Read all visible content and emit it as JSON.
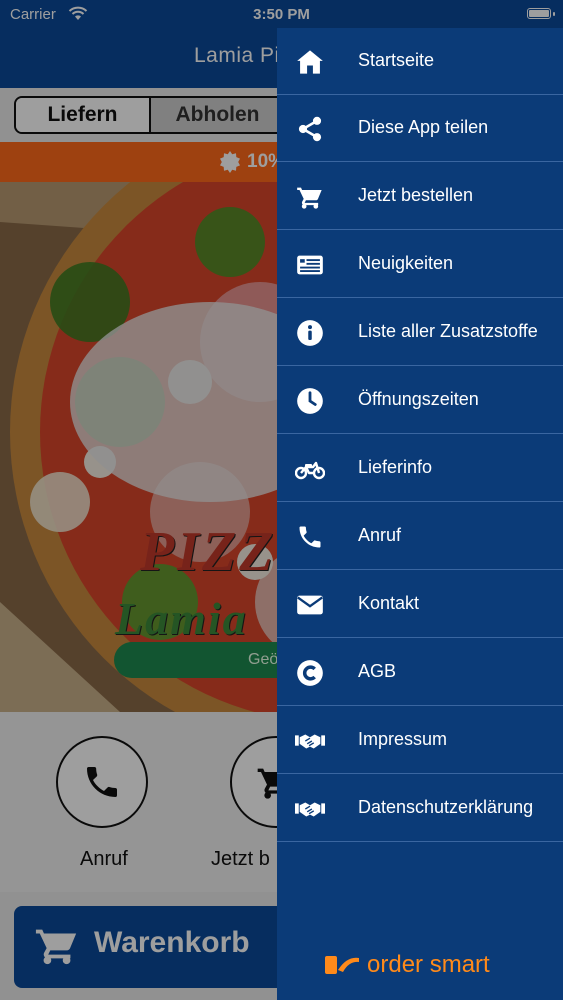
{
  "status_bar": {
    "carrier": "Carrier",
    "time": "3:50 PM"
  },
  "header": {
    "title": "Lamia Pi"
  },
  "order_mode": {
    "tabs": [
      {
        "label": "Liefern",
        "active": true
      },
      {
        "label": "Abholen",
        "active": false
      }
    ]
  },
  "promo": {
    "text": "10%"
  },
  "hero": {
    "logo_line1": "PIZZ",
    "logo_line2": "Lamia",
    "status_button": "Geö"
  },
  "quick_actions": [
    {
      "label": "Anruf",
      "icon": "phone-icon"
    },
    {
      "label": "Jetzt b",
      "icon": "cart-icon"
    }
  ],
  "cart_bar": {
    "label": "Warenkorb",
    "icon": "cart-icon"
  },
  "menu": {
    "items": [
      {
        "label": "Startseite",
        "icon": "home-icon"
      },
      {
        "label": "Diese App teilen",
        "icon": "share-icon"
      },
      {
        "label": "Jetzt bestellen",
        "icon": "cart-icon"
      },
      {
        "label": "Neuigkeiten",
        "icon": "news-icon"
      },
      {
        "label": "Liste aller Zusatzstoffe",
        "icon": "info-icon"
      },
      {
        "label": "Öffnungszeiten",
        "icon": "clock-icon"
      },
      {
        "label": "Lieferinfo",
        "icon": "motorcycle-icon"
      },
      {
        "label": "Anruf",
        "icon": "phone-icon"
      },
      {
        "label": "Kontakt",
        "icon": "mail-icon"
      },
      {
        "label": "AGB",
        "icon": "copyright-icon"
      },
      {
        "label": "Impressum",
        "icon": "handshake-icon"
      },
      {
        "label": "Datenschutzerklärung",
        "icon": "handshake-icon"
      }
    ],
    "brand": "order smart"
  },
  "colors": {
    "primary": "#0a4a9a",
    "drawer": "#0b3b78",
    "promo": "#ff6a1a",
    "open_button": "#1e8a4f",
    "brand": "#ff8a1a"
  }
}
